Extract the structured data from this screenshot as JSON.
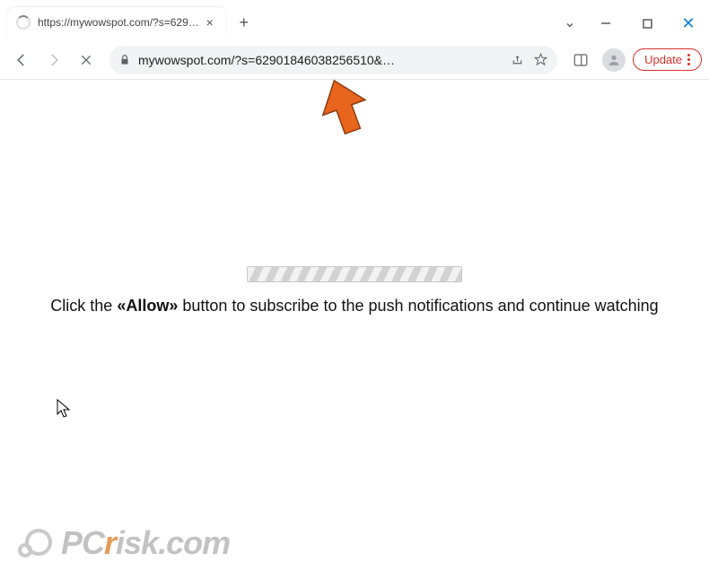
{
  "tab": {
    "title": "https://mywowspot.com/?s=629…"
  },
  "toolbar": {
    "url": "mywowspot.com/?s=62901846038256510&…",
    "update_label": "Update"
  },
  "page": {
    "text_before": "Click the ",
    "allow": "«Allow»",
    "text_after": " button to subscribe to the push notifications and continue watching"
  },
  "watermark": {
    "pre": "PC",
    "r": "r",
    "post": "isk.com"
  },
  "icons": {
    "close_tab": "×",
    "new_tab": "+",
    "caret": "⌄",
    "win_close": "✕"
  },
  "colors": {
    "update_border": "#d93025",
    "arrow": "#e8651d"
  }
}
